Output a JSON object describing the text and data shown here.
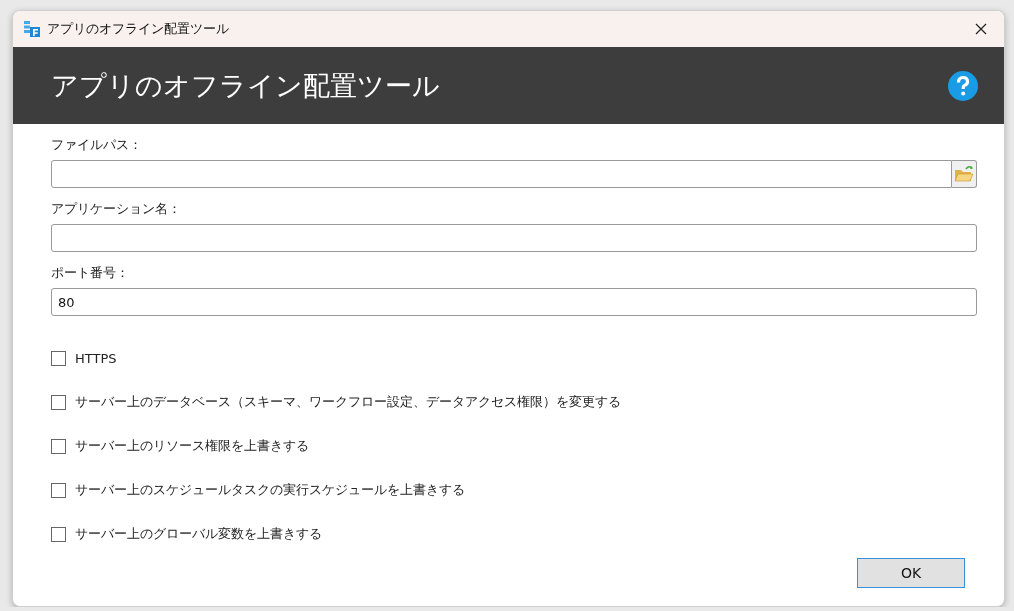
{
  "window": {
    "title": "アプリのオフライン配置ツール"
  },
  "header": {
    "title": "アプリのオフライン配置ツール"
  },
  "fields": [
    {
      "kind": "browse",
      "label": "ファイルパス："
    },
    {
      "kind": "text",
      "label": "アプリケーション名："
    },
    {
      "kind": "text",
      "label": "ポート番号：",
      "value": "80"
    }
  ],
  "options": [
    {
      "label": "HTTPS",
      "checked": false
    },
    {
      "label": "サーバー上のデータベース（スキーマ、ワークフロー設定、データアクセス権限）を変更する",
      "checked": false
    },
    {
      "label": "サーバー上のリソース権限を上書きする",
      "checked": false
    },
    {
      "label": "サーバー上のスケジュールタスクの実行スケジュールを上書きする",
      "checked": false
    },
    {
      "label": "サーバー上のグローバル変数を上書きする",
      "checked": false
    }
  ],
  "buttons": [
    "OK"
  ]
}
